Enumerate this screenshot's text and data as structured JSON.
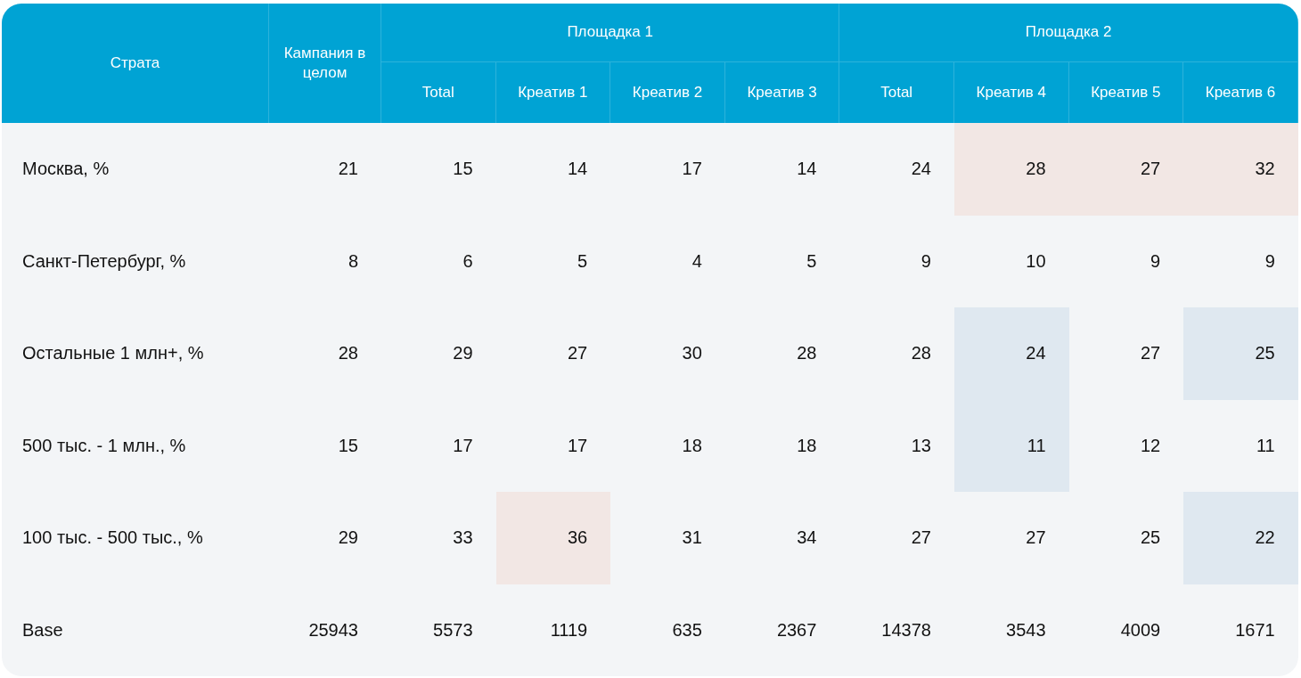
{
  "table": {
    "stratum_header": "Страта",
    "campaign_header": "Кампания в целом",
    "groups": [
      {
        "label": "Площадка 1",
        "columns": [
          "Total",
          "Креатив 1",
          "Креатив 2",
          "Креатив 3"
        ]
      },
      {
        "label": "Площадка 2",
        "columns": [
          "Total",
          "Креатив 4",
          "Креатив 5",
          "Креатив 6"
        ]
      }
    ],
    "rows": [
      {
        "label": "Москва, %",
        "cells": [
          {
            "value": "21"
          },
          {
            "value": "15"
          },
          {
            "value": "14"
          },
          {
            "value": "17"
          },
          {
            "value": "14"
          },
          {
            "value": "24"
          },
          {
            "value": "28",
            "color": "#f2e7e4"
          },
          {
            "value": "27",
            "color": "#f2e7e4"
          },
          {
            "value": "32",
            "color": "#f2e7e4"
          }
        ]
      },
      {
        "label": "Санкт-Петербург, %",
        "cells": [
          {
            "value": "8"
          },
          {
            "value": "6"
          },
          {
            "value": "5"
          },
          {
            "value": "4"
          },
          {
            "value": "5"
          },
          {
            "value": "9"
          },
          {
            "value": "10"
          },
          {
            "value": "9"
          },
          {
            "value": "9"
          }
        ]
      },
      {
        "label": "Остальные 1 млн+, %",
        "cells": [
          {
            "value": "28"
          },
          {
            "value": "29"
          },
          {
            "value": "27"
          },
          {
            "value": "30"
          },
          {
            "value": "28"
          },
          {
            "value": "28"
          },
          {
            "value": "24",
            "color": "#dfe8f0"
          },
          {
            "value": "27"
          },
          {
            "value": "25",
            "color": "#dfe8f0"
          }
        ]
      },
      {
        "label": "500 тыс. - 1 млн., %",
        "cells": [
          {
            "value": "15"
          },
          {
            "value": "17"
          },
          {
            "value": "17"
          },
          {
            "value": "18"
          },
          {
            "value": "18"
          },
          {
            "value": "13"
          },
          {
            "value": "11",
            "color": "#dfe8f0"
          },
          {
            "value": "12"
          },
          {
            "value": "11"
          }
        ]
      },
      {
        "label": "100 тыс. - 500 тыс., %",
        "cells": [
          {
            "value": "29"
          },
          {
            "value": "33"
          },
          {
            "value": "36",
            "color": "#f2e7e4"
          },
          {
            "value": "31"
          },
          {
            "value": "34"
          },
          {
            "value": "27"
          },
          {
            "value": "27"
          },
          {
            "value": "25"
          },
          {
            "value": "22",
            "color": "#dfe8f0"
          }
        ]
      },
      {
        "label": "Base",
        "cells": [
          {
            "value": "25943"
          },
          {
            "value": "5573"
          },
          {
            "value": "1119"
          },
          {
            "value": "635"
          },
          {
            "value": "2367"
          },
          {
            "value": "14378"
          },
          {
            "value": "3543"
          },
          {
            "value": "4009"
          },
          {
            "value": "1671"
          }
        ]
      }
    ]
  }
}
